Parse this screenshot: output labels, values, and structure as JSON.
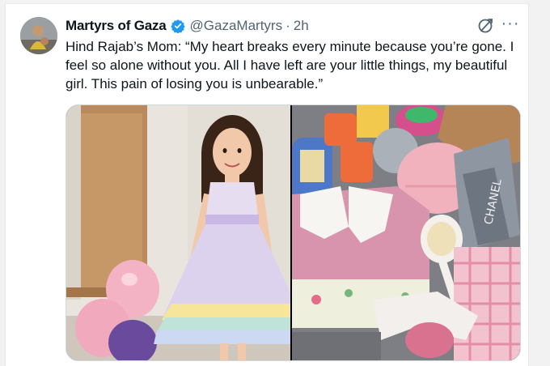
{
  "tweet": {
    "author_name": "Martyrs of Gaza",
    "handle": "@GazaMartyrs",
    "separator": "·",
    "time": "2h",
    "text": "Hind Rajab’s Mom: “My heart breaks every minute because you’re gone. I feel so alone without you. All I have left are your little things, my beautiful girl. This pain of losing you is unbearable.”",
    "more_label": "···"
  },
  "media": {
    "left_photo": "girl-in-pastel-dress-with-balloons",
    "right_photo": "childs-belongings-clothes-toys-hairbrush",
    "hat_label": "CHANEL"
  },
  "colors": {
    "verified": "#1d9bf0",
    "secondary_text": "#536471",
    "primary_text": "#0f1419"
  }
}
